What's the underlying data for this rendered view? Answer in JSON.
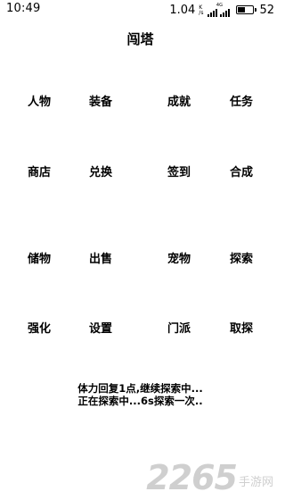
{
  "status_bar": {
    "time": "10:49",
    "net_speed": "1.04",
    "net_speed_unit_top": "K",
    "net_speed_unit_bottom": "/s",
    "network_tag": "4G",
    "battery_level": "52",
    "battery_fraction": 0.52,
    "icons": [
      "network-speed-icon",
      "signal-icon",
      "battery-icon"
    ]
  },
  "page": {
    "title": "闯塔"
  },
  "menu": {
    "items": [
      {
        "label": "人物"
      },
      {
        "label": "装备"
      },
      {
        "label": "成就"
      },
      {
        "label": "任务"
      },
      {
        "label": "商店"
      },
      {
        "label": "兑换"
      },
      {
        "label": "签到"
      },
      {
        "label": "合成"
      },
      {
        "label": "储物"
      },
      {
        "label": "出售"
      },
      {
        "label": "宠物"
      },
      {
        "label": "探索"
      },
      {
        "label": "强化"
      },
      {
        "label": "设置"
      },
      {
        "label": "门派"
      },
      {
        "label": "取探"
      }
    ]
  },
  "status_log": {
    "line1": "体力回复1点,继续探索中...",
    "line2": "正在探索中...6s探索一次.."
  },
  "watermark": {
    "number": "2265",
    "text": "手游网"
  }
}
